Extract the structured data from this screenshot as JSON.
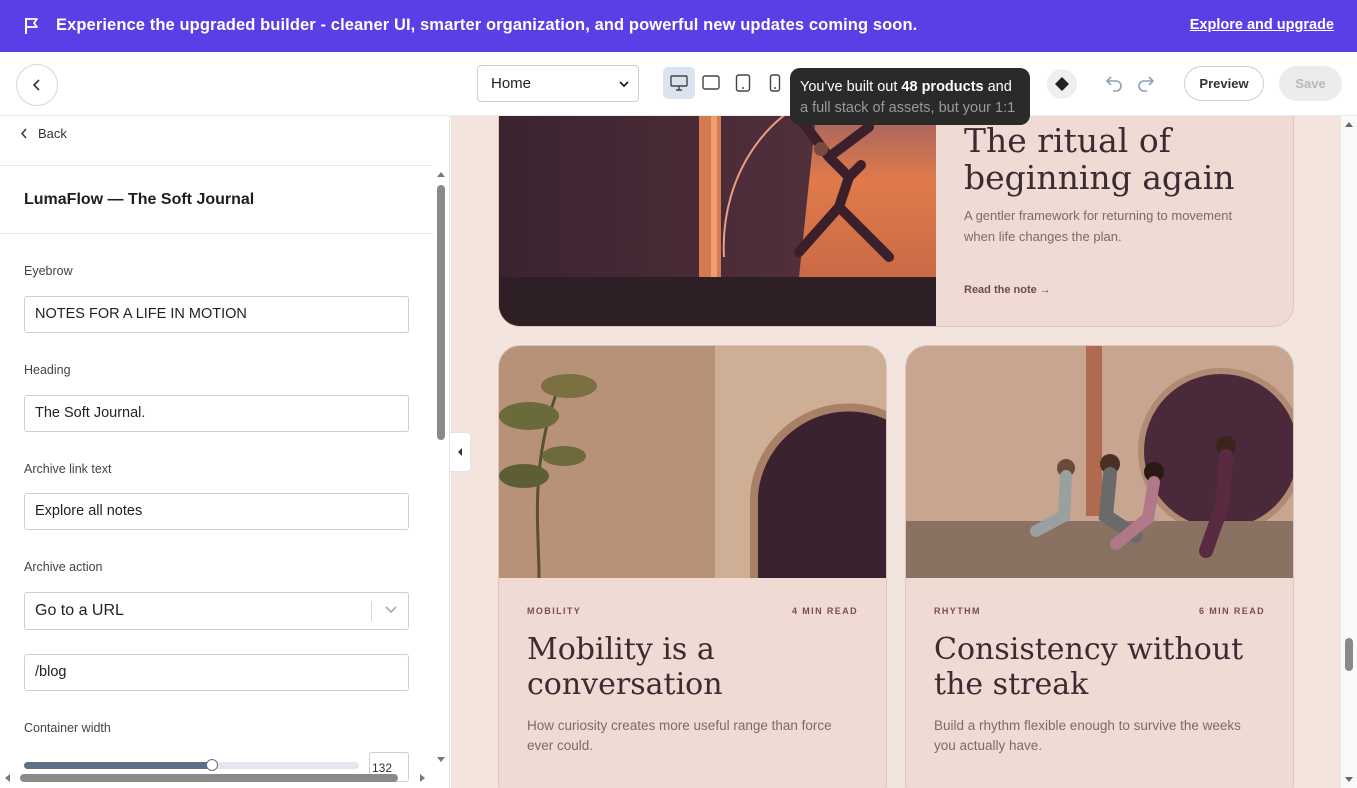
{
  "banner": {
    "message": "Experience the upgraded builder - cleaner UI, smarter organization, and powerful new updates coming soon.",
    "link": "Explore and upgrade",
    "background": "#5b3ee6"
  },
  "toolbar": {
    "page_select_value": "Home",
    "devices": [
      "desktop-icon",
      "tablet-landscape-icon",
      "tablet-icon",
      "mobile-icon"
    ],
    "active_device": "desktop",
    "tooltip": {
      "pre": "You've built out ",
      "bold": "48 products",
      "post": " and",
      "line2": "a full stack of assets, but your 1:1"
    },
    "preview_label": "Preview",
    "save_label": "Save"
  },
  "sidebar": {
    "back_label": "Back",
    "section_title": "LumaFlow — The Soft Journal",
    "fields": {
      "eyebrow_label": "Eyebrow",
      "eyebrow_value": "NOTES FOR A LIFE IN MOTION",
      "heading_label": "Heading",
      "heading_value": "The Soft Journal.",
      "archive_link_label": "Archive link text",
      "archive_link_value": "Explore all notes",
      "archive_action_label": "Archive action",
      "archive_action_value": "Go to a URL",
      "archive_url_value": "/blog",
      "container_width_label": "Container width",
      "container_width_value": "132",
      "container_width_fraction": 0.56
    }
  },
  "canvas": {
    "featured": {
      "title": "The ritual of beginning again",
      "description": "A gentler framework for returning to movement when life changes the plan.",
      "link": "Read the note →"
    },
    "cards": [
      {
        "eyebrow": "MOBILITY",
        "read_time": "4 MIN READ",
        "title": "Mobility is a conversation",
        "description": "How curiosity creates more useful range than force ever could."
      },
      {
        "eyebrow": "RHYTHM",
        "read_time": "6 MIN READ",
        "title": "Consistency without the streak",
        "description": "Build a rhythm flexible enough to survive the weeks you actually have."
      }
    ]
  }
}
